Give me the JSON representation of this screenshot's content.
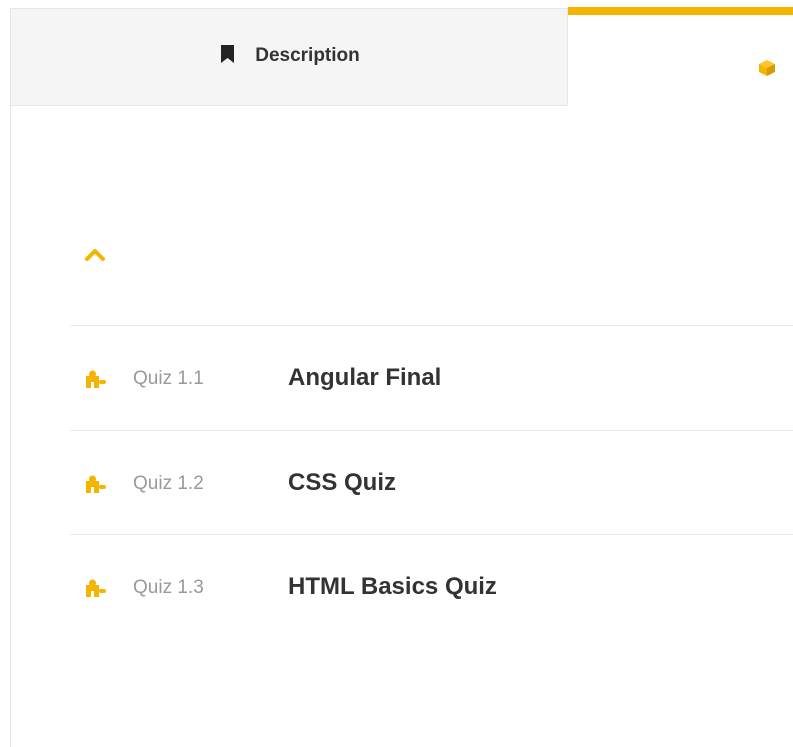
{
  "tabs": {
    "description": {
      "label": "Description",
      "icon": "bookmark-icon",
      "active": false
    },
    "curriculum": {
      "label": "",
      "icon": "cube-icon",
      "active": true
    }
  },
  "section": {
    "toggle_icon": "chevron-up-icon",
    "expanded": true
  },
  "lessons": [
    {
      "icon": "puzzle-icon",
      "number": "Quiz 1.1",
      "title": "Angular Final"
    },
    {
      "icon": "puzzle-icon",
      "number": "Quiz 1.2",
      "title": "CSS Quiz"
    },
    {
      "icon": "puzzle-icon",
      "number": "Quiz 1.3",
      "title": "HTML Basics Quiz"
    }
  ],
  "colors": {
    "accent": "#f5b400",
    "text_primary": "#333333",
    "text_muted": "#999999",
    "tab_inactive_bg": "#f5f5f5",
    "divider": "#e8e8e8"
  }
}
